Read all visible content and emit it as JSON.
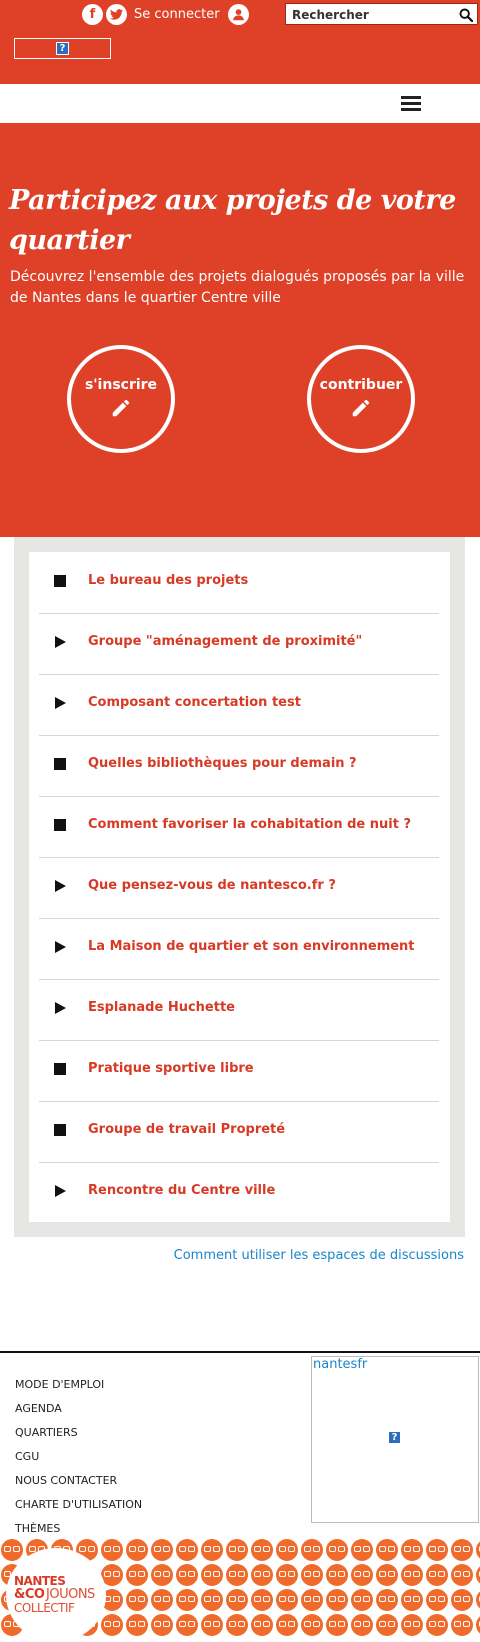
{
  "header": {
    "facebook_glyph": "f",
    "twitter_glyph": "t",
    "login_label": "Se connecter",
    "search_placeholder": "Rechercher",
    "frame_glyph": "?"
  },
  "hero": {
    "title": "Participez aux projets de votre quartier",
    "description": "Découvrez l'ensemble des projets dialogués proposés par la ville de Nantes dans le quartier Centre ville",
    "signup_label": "s'inscrire",
    "contribute_label": "contribuer"
  },
  "projects": [
    {
      "label": "Le bureau des projets",
      "marker": "square"
    },
    {
      "label": "Groupe \"aménagement de proximité\"",
      "marker": "play"
    },
    {
      "label": "Composant concertation test",
      "marker": "play"
    },
    {
      "label": "Quelles bibliothèques pour demain ?",
      "marker": "square"
    },
    {
      "label": "Comment favoriser la cohabitation de nuit ?",
      "marker": "square"
    },
    {
      "label": "Que pensez-vous de nantesco.fr ?",
      "marker": "play"
    },
    {
      "label": "La Maison de quartier et son environnement",
      "marker": "play"
    },
    {
      "label": "Esplanade Huchette",
      "marker": "play"
    },
    {
      "label": "Pratique sportive libre",
      "marker": "square"
    },
    {
      "label": "Groupe de travail Propreté",
      "marker": "square"
    },
    {
      "label": "Rencontre du Centre ville",
      "marker": "play"
    }
  ],
  "help_link": "Comment utiliser les espaces de discussions",
  "footer": {
    "menu": [
      "MODE D'EMPLOI",
      "AGENDA",
      "QUARTIERS",
      "CGU",
      "NOUS CONTACTER",
      "CHARTE D'UTILISATION",
      "THÈMES"
    ],
    "twitter_name": "nantesfr",
    "logo": {
      "line1": "NANTES",
      "line2a": "&CO",
      "line2b": "JOUONS",
      "line3": "COLLECTIF"
    }
  },
  "colors": {
    "brand": "#de4128",
    "link": "#1a86c9",
    "emoji": "#ef6a2b"
  }
}
